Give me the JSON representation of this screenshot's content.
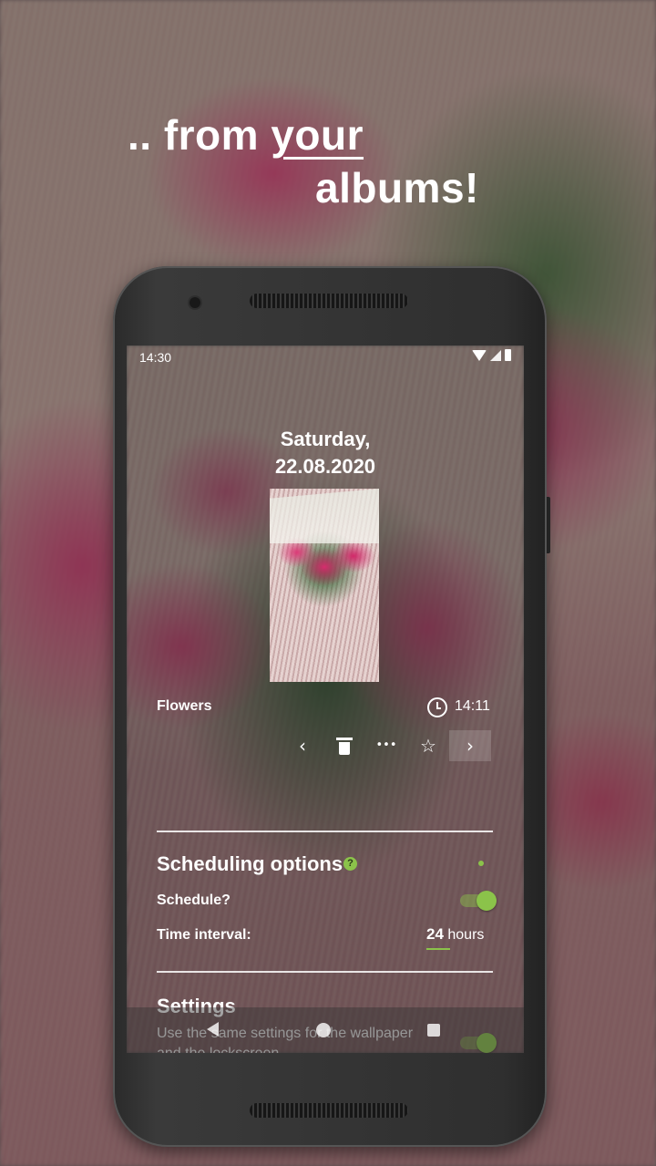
{
  "headline": {
    "line1_prefix": ".. from ",
    "line1_emph": "your",
    "line2": "albums!"
  },
  "status_bar": {
    "time": "14:30"
  },
  "photo": {
    "date_line1": "Saturday,",
    "date_line2": "22.08.2020",
    "album": "Flowers",
    "time": "14:11"
  },
  "actions": {
    "prev": "‹",
    "more": "•••",
    "favorite": "☆",
    "next": "›"
  },
  "scheduling": {
    "title": "Scheduling options",
    "help": "?",
    "schedule_label": "Schedule?",
    "schedule_enabled": true,
    "interval_label": "Time interval:",
    "interval_value": "24",
    "interval_unit": "hours"
  },
  "settings": {
    "title": "Settings",
    "description": "Use the same settings for the wallpaper and the lockscreen",
    "enabled": true
  },
  "colors": {
    "accent": "#8bc34a"
  }
}
